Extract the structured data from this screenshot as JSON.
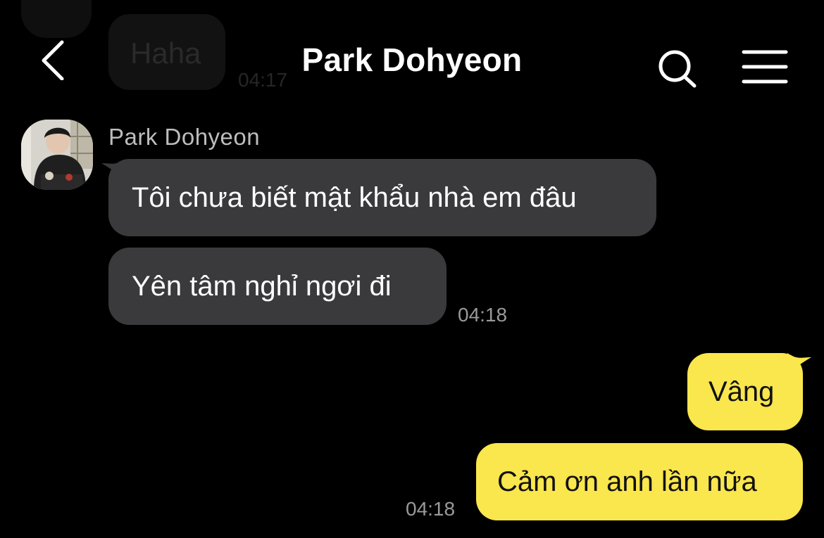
{
  "header": {
    "title": "Park Dohyeon",
    "back_icon": "chevron-left-icon",
    "search_icon": "search-icon",
    "menu_icon": "hamburger-menu-icon"
  },
  "previous_message": {
    "text": "Haha",
    "time": "04:17"
  },
  "incoming": {
    "sender_name": "Park Dohyeon",
    "avatar": "avatar-photo",
    "messages": [
      {
        "text": "Tôi chưa biết mật khẩu nhà em đâu"
      },
      {
        "text": "Yên tâm nghỉ ngơi đi"
      }
    ],
    "time": "04:18"
  },
  "outgoing": {
    "messages": [
      {
        "text": "Vâng"
      },
      {
        "text": "Cảm ơn anh lần nữa"
      }
    ],
    "time": "04:18"
  },
  "colors": {
    "background": "#000000",
    "incoming_bubble": "#3a3a3c",
    "outgoing_bubble": "#fae64d",
    "timestamp": "#9a9a9a"
  }
}
